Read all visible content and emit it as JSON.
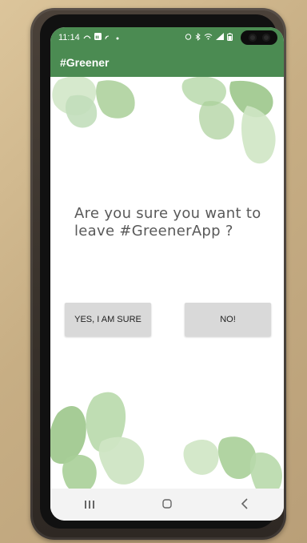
{
  "status_bar": {
    "time": "11:14",
    "left_icons": [
      "wifi-calling-icon",
      "linkedin-icon",
      "cast-icon",
      "dot-icon"
    ],
    "right_icons": [
      "alarm-icon",
      "bluetooth-icon",
      "wifi-icon",
      "signal-icon",
      "battery-icon"
    ]
  },
  "app_bar": {
    "title": "#Greener"
  },
  "dialog": {
    "message": "Are you sure you want to leave #GreenerApp ?",
    "yes_label": "YES, I AM SURE",
    "no_label": "NO!"
  },
  "nav_bar": {
    "recents_icon": "recents-icon",
    "home_icon": "home-icon",
    "back_icon": "back-icon"
  },
  "colors": {
    "app_bar": "#4b8b52",
    "button_bg": "#d9d9d9",
    "message_text": "#595959",
    "leaf_green": "#8fbf82"
  }
}
